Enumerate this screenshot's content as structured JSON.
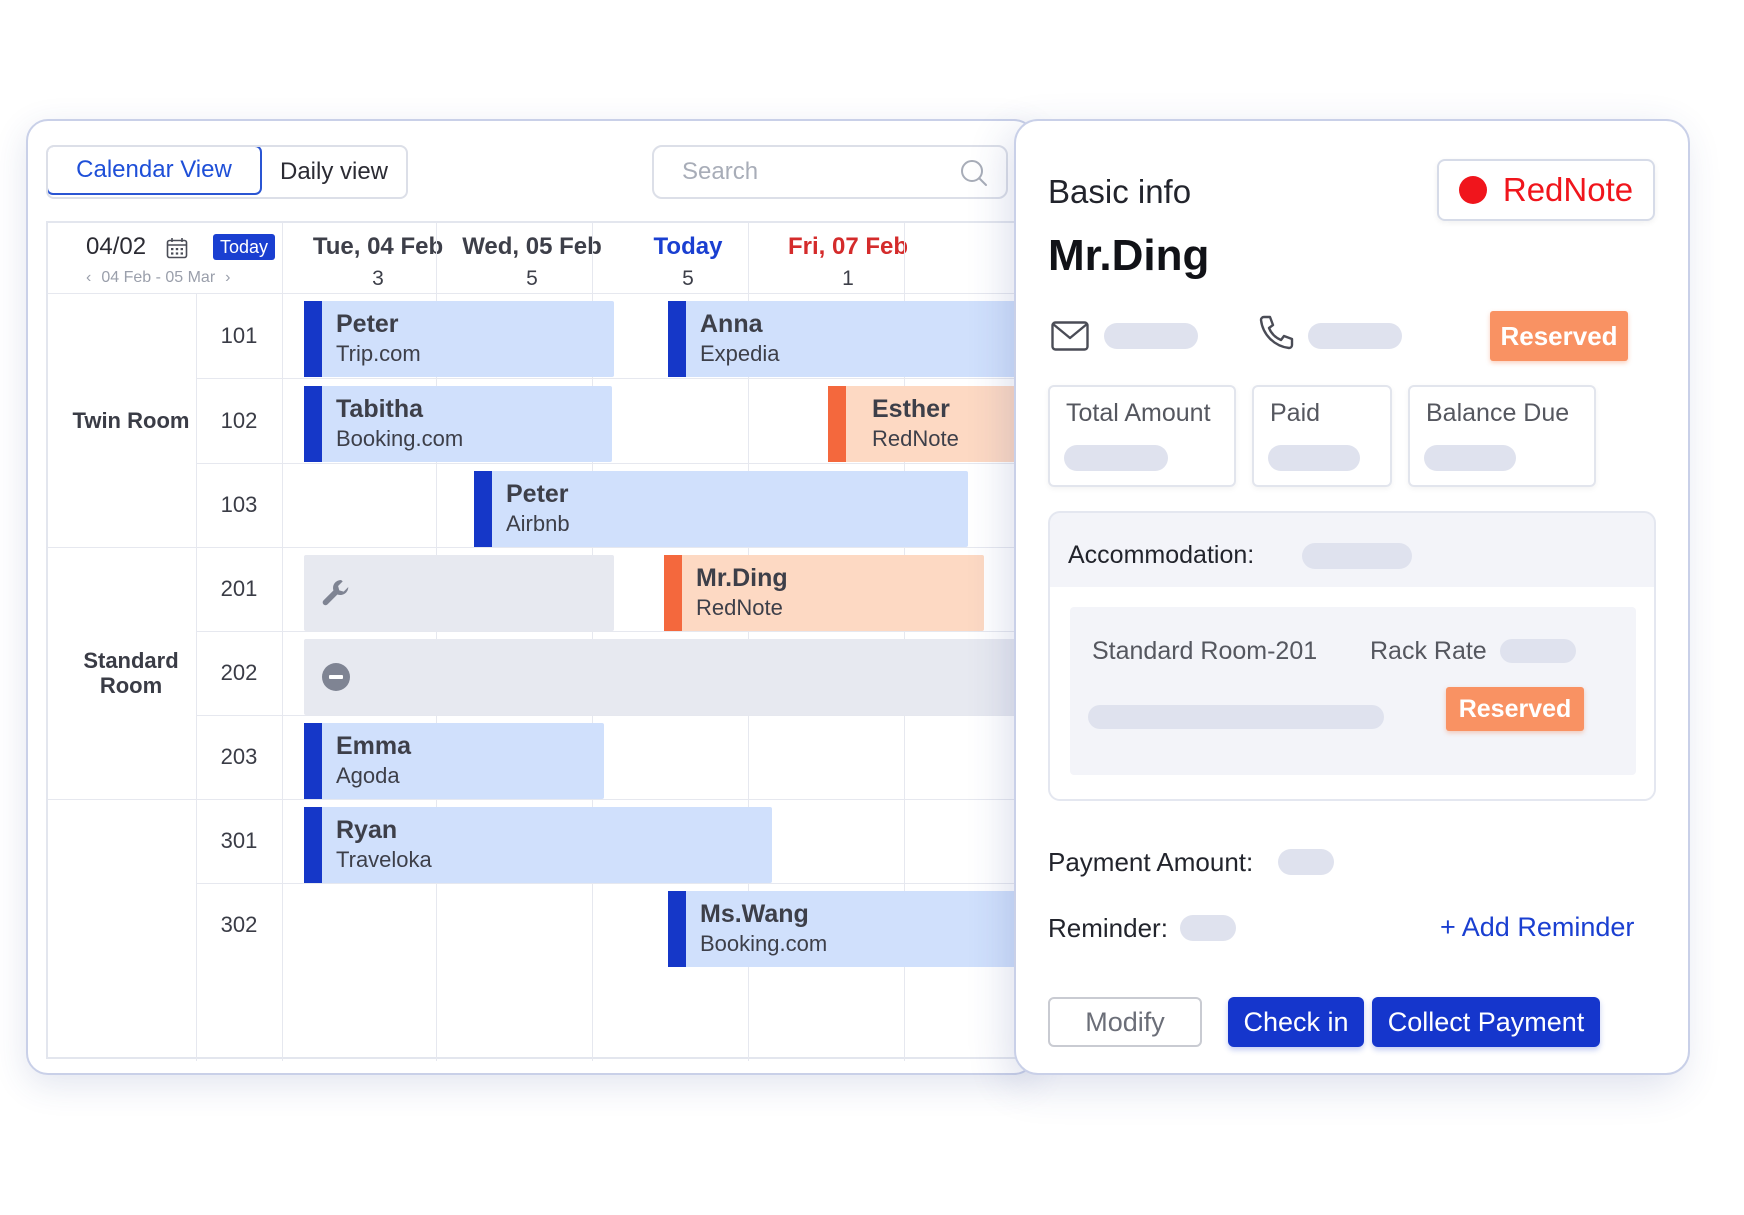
{
  "toolbar": {
    "calendar_view_label": "Calendar View",
    "daily_view_label": "Daily view",
    "search_placeholder": "Search"
  },
  "date_nav": {
    "current_date": "04/02",
    "today_label": "Today",
    "range": "04 Feb - 05 Mar",
    "prev_arrow": "‹",
    "next_arrow": "›"
  },
  "days": [
    {
      "label": "Tue, 04 Feb",
      "count": "3",
      "color": "#3d3f49"
    },
    {
      "label": "Wed, 05 Feb",
      "count": "5",
      "color": "#3d3f49"
    },
    {
      "label": "Today",
      "count": "5",
      "color": "#1a3fd1"
    },
    {
      "label": "Fri, 07 Feb",
      "count": "1",
      "color": "#d42b2b"
    }
  ],
  "room_types": [
    {
      "name": "Twin Room"
    },
    {
      "name": "Standard Room"
    },
    {
      "name": ""
    }
  ],
  "rooms": [
    "101",
    "102",
    "103",
    "201",
    "202",
    "203",
    "301",
    "302"
  ],
  "bookings": [
    {
      "guest": "Peter",
      "source": "Trip.com",
      "color": "blue"
    },
    {
      "guest": "Anna",
      "source": "Expedia",
      "color": "blue"
    },
    {
      "guest": "Tabitha",
      "source": "Booking.com",
      "color": "blue"
    },
    {
      "guest": "Esther",
      "source": "RedNote",
      "color": "orange"
    },
    {
      "guest": "Peter",
      "source": "Airbnb",
      "color": "blue"
    },
    {
      "guest": "Mr.Ding",
      "source": "RedNote",
      "color": "orange"
    },
    {
      "guest": "Emma",
      "source": "Agoda",
      "color": "blue"
    },
    {
      "guest": "Ryan",
      "source": "Traveloka",
      "color": "blue"
    },
    {
      "guest": "Ms.Wang",
      "source": "Booking.com",
      "color": "blue"
    }
  ],
  "blocks": [
    {
      "type": "maintenance",
      "icon": "wrench-icon"
    },
    {
      "type": "blocked",
      "icon": "minus-circle-icon"
    }
  ],
  "panel": {
    "title": "Basic info",
    "channel": "RedNote",
    "channel_color": "#f0151c",
    "guest_name": "Mr.Ding",
    "status": "Reserved",
    "amounts": {
      "total_label": "Total Amount",
      "paid_label": "Paid",
      "balance_label": "Balance Due"
    },
    "accommodation_label": "Accommodation:",
    "room_line": "Standard Room-201",
    "rate_label": "Rack Rate",
    "room_status": "Reserved",
    "payment_label": "Payment Amount:",
    "reminder_label": "Reminder:",
    "add_reminder": "+ Add Reminder",
    "buttons": {
      "modify": "Modify",
      "check_in": "Check in",
      "collect_payment": "Collect Payment"
    }
  },
  "colors": {
    "accent": "#1a3fd1",
    "booking_blue": "#d0e0fc",
    "booking_orange": "#fdd9c3",
    "status_orange": "#f99263"
  }
}
